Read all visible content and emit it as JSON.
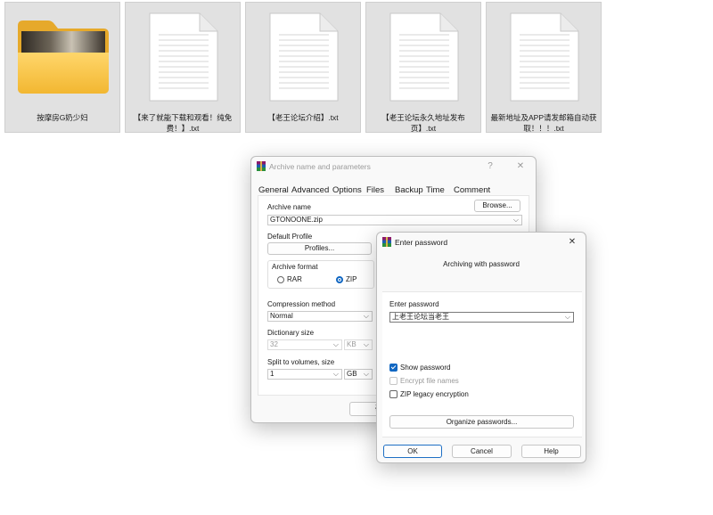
{
  "files": [
    {
      "name": "按摩房G奶少妇",
      "kind": "folder"
    },
    {
      "name": "【来了就能下载和观看！纯免费！】.txt",
      "kind": "txt"
    },
    {
      "name": "【老王论坛介绍】.txt",
      "kind": "txt"
    },
    {
      "name": "【老王论坛永久地址发布页】.txt",
      "kind": "txt"
    },
    {
      "name": "最新地址及APP请发邮箱自动获取！！！.txt",
      "kind": "txt"
    }
  ],
  "archive_dialog": {
    "title": "Archive name and parameters",
    "help_glyph": "?",
    "close_glyph": "✕",
    "tabs": [
      "General",
      "Advanced",
      "Options",
      "Files",
      "Backup",
      "Time",
      "Comment"
    ],
    "archive_name_label": "Archive name",
    "browse_label": "Browse...",
    "archive_name_value": "GTONOONE.zip",
    "default_profile_label": "Default Profile",
    "profiles_label": "Profiles...",
    "archive_format_label": "Archive format",
    "format_options": [
      "RAR",
      "ZIP"
    ],
    "selected_format": "ZIP",
    "compression_method_label": "Compression method",
    "compression_method_value": "Normal",
    "dictionary_size_label": "Dictionary size",
    "dictionary_size_value": "32",
    "dictionary_unit": "KB",
    "split_label": "Split to volumes, size",
    "split_value": "1",
    "split_unit": "GB",
    "ok_partial": "确"
  },
  "password_dialog": {
    "title": "Enter password",
    "close_glyph": "✕",
    "subtitle": "Archiving with password",
    "enter_password_label": "Enter password",
    "password_value": "上老王论坛当老王",
    "checkboxes": [
      {
        "label": "Show password",
        "checked": true,
        "disabled": false
      },
      {
        "label": "Encrypt file names",
        "checked": false,
        "disabled": true
      },
      {
        "label": "ZIP legacy encryption",
        "checked": false,
        "disabled": false
      }
    ],
    "organize_label": "Organize passwords...",
    "ok_label": "OK",
    "cancel_label": "Cancel",
    "help_label": "Help"
  },
  "colors": {
    "accent": "#1167c2",
    "tile_bg": "#e1e1e1",
    "folder": "#f5c242"
  }
}
